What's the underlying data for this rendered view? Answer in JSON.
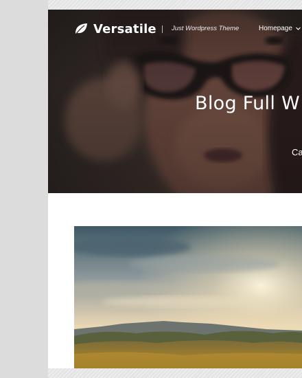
{
  "site": {
    "logo_text": "Versatile",
    "tagline": "Just Wordpress Theme"
  },
  "nav": {
    "home_label": "Homepage"
  },
  "hero": {
    "title": "Blog Full W",
    "subtitle": "Ca"
  },
  "icons": {
    "logo": "leaf-icon",
    "nav": "chevron-down-icon"
  },
  "colors": {
    "page_bg": "#e4e4e4",
    "content_bg": "#ffffff",
    "hero_text": "#ffffff"
  }
}
